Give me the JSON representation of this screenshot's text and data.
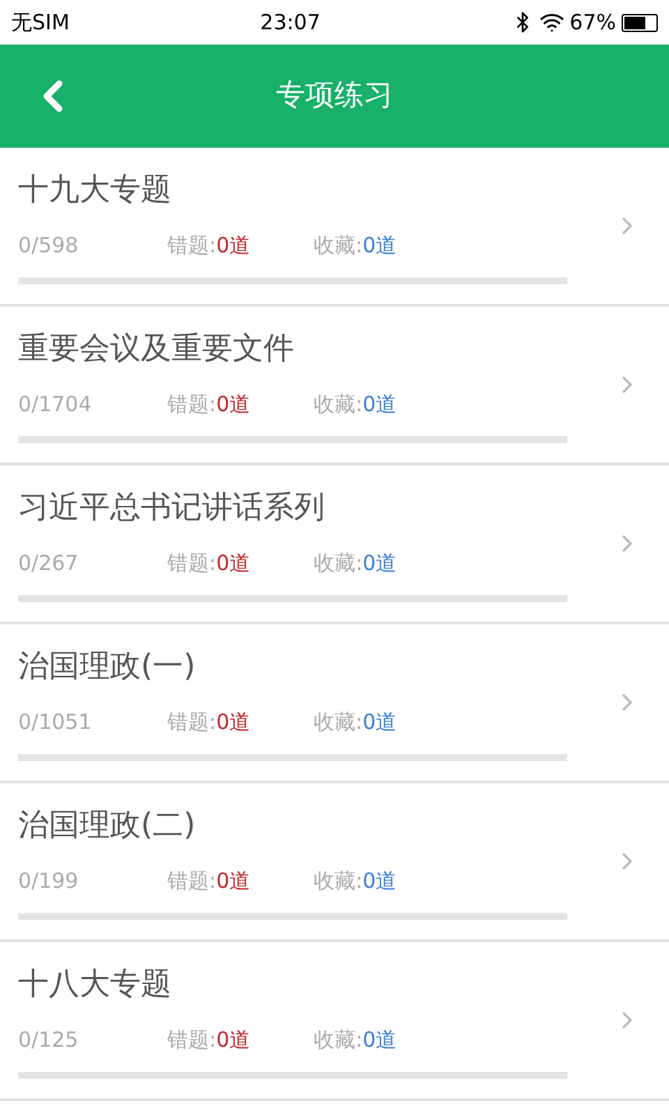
{
  "status_bar": {
    "carrier": "无SIM",
    "time": "23:07",
    "battery": "67%"
  },
  "header": {
    "title": "专项练习"
  },
  "topics": [
    {
      "title": "十九大专题",
      "progress": "0/598",
      "wrong_label": "错题:",
      "wrong_count": "0道",
      "fav_label": "收藏:",
      "fav_count": "0道",
      "level": 0
    },
    {
      "title": "重要会议及重要文件",
      "progress": "0/1704",
      "wrong_label": "错题:",
      "wrong_count": "0道",
      "fav_label": "收藏:",
      "fav_count": "0道",
      "level": 0
    },
    {
      "title": "习近平总书记讲话系列",
      "progress": "0/267",
      "wrong_label": "错题:",
      "wrong_count": "0道",
      "fav_label": "收藏:",
      "fav_count": "0道",
      "level": 0
    },
    {
      "title": "治国理政(一)",
      "progress": "0/1051",
      "wrong_label": "错题:",
      "wrong_count": "0道",
      "fav_label": "收藏:",
      "fav_count": "0道",
      "level": 0
    },
    {
      "title": "治国理政(二)",
      "progress": "0/199",
      "wrong_label": "错题:",
      "wrong_count": "0道",
      "fav_label": "收藏:",
      "fav_count": "0道",
      "level": 0
    },
    {
      "title": "十八大专题",
      "progress": "0/125",
      "wrong_label": "错题:",
      "wrong_count": "0道",
      "fav_label": "收藏:",
      "fav_count": "0道",
      "level": 0
    }
  ]
}
